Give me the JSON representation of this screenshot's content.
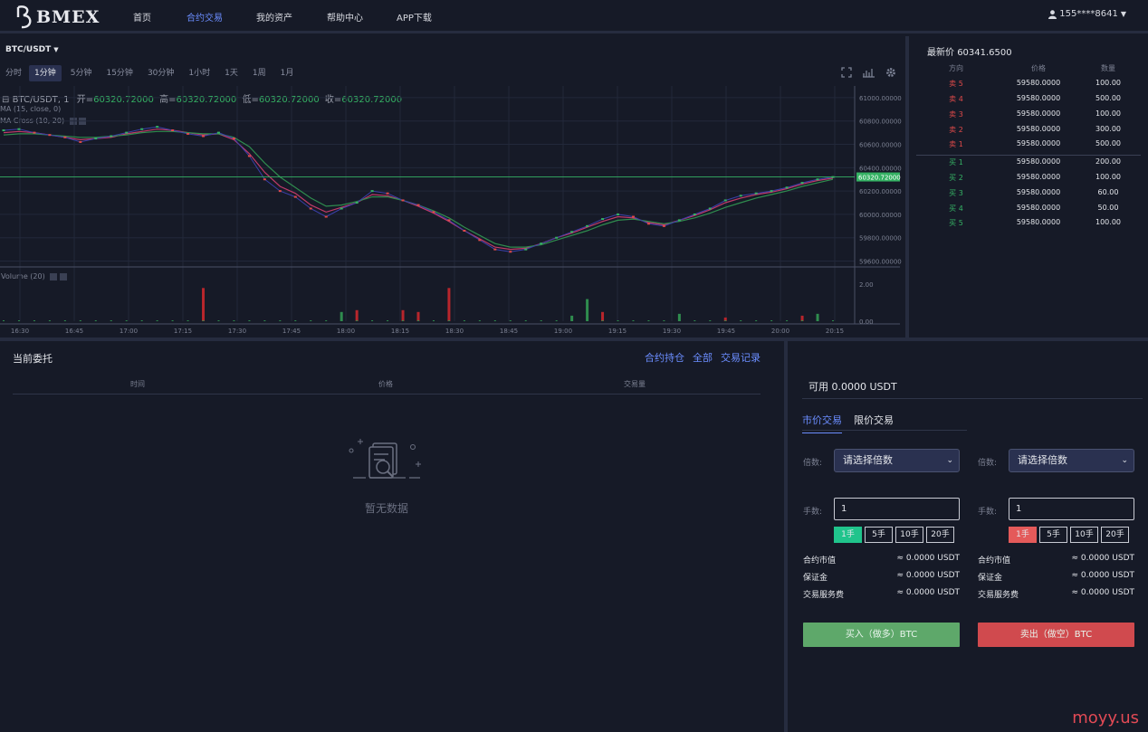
{
  "brand": {
    "logo_text": "BMEX"
  },
  "nav": {
    "items": [
      "首页",
      "合约交易",
      "我的资产",
      "帮助中心",
      "APP下载"
    ],
    "active": 1
  },
  "user": {
    "phone": "155****8641"
  },
  "chart_header": {
    "pair": "BTC/USDT",
    "intervals": [
      "分时",
      "1分钟",
      "5分钟",
      "15分钟",
      "30分钟",
      "1小时",
      "1天",
      "1周",
      "1月"
    ],
    "active_interval": 1
  },
  "chart_legend": {
    "symbol": "BTC/USDT, 1",
    "open_label": "开=",
    "open": "60320.72000",
    "high_label": "高=",
    "high": "60320.72000",
    "low_label": "低=",
    "low": "60320.72000",
    "close_label": "收=",
    "close": "60320.72000",
    "ma": "MA (15, close, 0)",
    "ma_cross": "MA Cross (10, 20)",
    "volume": "Volume (20)"
  },
  "chart_data": {
    "type": "candlestick",
    "x_ticks": [
      "16:30",
      "16:45",
      "17:00",
      "17:15",
      "17:30",
      "17:45",
      "18:00",
      "18:15",
      "18:30",
      "18:45",
      "19:00",
      "19:15",
      "19:30",
      "19:45",
      "20:00",
      "20:15"
    ],
    "y_ticks": [
      "61000.00000",
      "60800.00000",
      "60600.00000",
      "60400.00000",
      "60200.00000",
      "60000.00000",
      "59800.00000",
      "59600.00000"
    ],
    "ylim": [
      59550,
      61100
    ],
    "last_price_label": "60320.72000",
    "last_price": 60320.72,
    "price_series": [
      {
        "name": "price",
        "values": [
          60720,
          60730,
          60700,
          60680,
          60660,
          60620,
          60650,
          60670,
          60700,
          60730,
          60750,
          60720,
          60690,
          60670,
          60700,
          60650,
          60500,
          60300,
          60200,
          60150,
          60050,
          59980,
          60050,
          60100,
          60200,
          60180,
          60120,
          60080,
          60020,
          59950,
          59860,
          59780,
          59700,
          59680,
          59700,
          59750,
          59800,
          59850,
          59900,
          59960,
          60000,
          59980,
          59920,
          59900,
          59950,
          60000,
          60050,
          60120,
          60160,
          60180,
          60200,
          60230,
          60270,
          60300,
          60320
        ]
      },
      {
        "name": "ma1",
        "values": [
          60700,
          60710,
          60700,
          60680,
          60660,
          60640,
          60650,
          60660,
          60690,
          60710,
          60730,
          60720,
          60700,
          60680,
          60690,
          60640,
          60520,
          60360,
          60240,
          60180,
          60080,
          60020,
          60060,
          60100,
          60170,
          60160,
          60120,
          60070,
          60010,
          59940,
          59860,
          59790,
          59720,
          59700,
          59710,
          59750,
          59800,
          59840,
          59890,
          59940,
          59980,
          59970,
          59930,
          59910,
          59950,
          59990,
          60040,
          60100,
          60140,
          60170,
          60190,
          60220,
          60260,
          60290,
          60310
        ]
      },
      {
        "name": "ma2",
        "values": [
          60680,
          60690,
          60690,
          60680,
          60670,
          60660,
          60660,
          60670,
          60680,
          60700,
          60710,
          60710,
          60700,
          60690,
          60690,
          60660,
          60580,
          60440,
          60320,
          60230,
          60140,
          60070,
          60080,
          60110,
          60150,
          60150,
          60120,
          60080,
          60030,
          59970,
          59890,
          59820,
          59750,
          59720,
          59720,
          59740,
          59780,
          59820,
          59860,
          59910,
          59950,
          59960,
          59940,
          59920,
          59940,
          59970,
          60010,
          60060,
          60100,
          60140,
          60170,
          60200,
          60240,
          60270,
          60300
        ]
      }
    ],
    "volume": {
      "ylim": [
        0,
        2.6
      ],
      "y_ticks": [
        "2.00",
        "0.00"
      ],
      "bars": [
        {
          "i": 13,
          "v": 1.8,
          "up": false
        },
        {
          "i": 22,
          "v": 0.5,
          "up": true
        },
        {
          "i": 23,
          "v": 0.6,
          "up": false
        },
        {
          "i": 26,
          "v": 0.6,
          "up": false
        },
        {
          "i": 27,
          "v": 0.5,
          "up": false
        },
        {
          "i": 29,
          "v": 1.8,
          "up": false
        },
        {
          "i": 37,
          "v": 0.3,
          "up": true
        },
        {
          "i": 38,
          "v": 1.2,
          "up": true
        },
        {
          "i": 39,
          "v": 0.5,
          "up": false
        },
        {
          "i": 44,
          "v": 0.4,
          "up": true
        },
        {
          "i": 47,
          "v": 0.2,
          "up": false
        },
        {
          "i": 52,
          "v": 0.3,
          "up": false
        },
        {
          "i": 53,
          "v": 0.4,
          "up": true
        }
      ]
    }
  },
  "orderbook": {
    "last_label": "最新价",
    "last_price": "60341.6500",
    "headers": [
      "方向",
      "价格",
      "数量"
    ],
    "asks": [
      {
        "side": "卖 5",
        "price": "59580.0000",
        "qty": "100.00"
      },
      {
        "side": "卖 4",
        "price": "59580.0000",
        "qty": "500.00"
      },
      {
        "side": "卖 3",
        "price": "59580.0000",
        "qty": "100.00"
      },
      {
        "side": "卖 2",
        "price": "59580.0000",
        "qty": "300.00"
      },
      {
        "side": "卖 1",
        "price": "59580.0000",
        "qty": "500.00"
      }
    ],
    "bids": [
      {
        "side": "买 1",
        "price": "59580.0000",
        "qty": "200.00"
      },
      {
        "side": "买 2",
        "price": "59580.0000",
        "qty": "100.00"
      },
      {
        "side": "买 3",
        "price": "59580.0000",
        "qty": "60.00"
      },
      {
        "side": "买 4",
        "price": "59580.0000",
        "qty": "50.00"
      },
      {
        "side": "买 5",
        "price": "59580.0000",
        "qty": "100.00"
      }
    ]
  },
  "orders": {
    "title": "当前委托",
    "links": [
      "合约持仓",
      "全部",
      "交易记录"
    ],
    "headers": [
      "时间",
      "价格",
      "交易量"
    ],
    "empty": "暂无数据"
  },
  "trade": {
    "available": "可用 0.0000 USDT",
    "tabs": [
      "市价交易",
      "限价交易"
    ],
    "leverage_label": "倍数:",
    "leverage_placeholder": "请选择倍数",
    "lots_label": "手数:",
    "lots_value": "1",
    "lot_options": [
      "1手",
      "5手",
      "10手",
      "20手"
    ],
    "info": [
      {
        "k": "合约市值",
        "v": "≈ 0.0000 USDT"
      },
      {
        "k": "保证金",
        "v": "≈ 0.0000 USDT"
      },
      {
        "k": "交易服务费",
        "v": "≈ 0.0000 USDT"
      }
    ],
    "buy_label": "买入（做多）BTC",
    "sell_label": "卖出（做空）BTC"
  },
  "watermark": "moyy.us",
  "colors": {
    "up": "#35b264",
    "down": "#e04a4a",
    "accent": "#6b8dff",
    "bg": "#161a27"
  }
}
